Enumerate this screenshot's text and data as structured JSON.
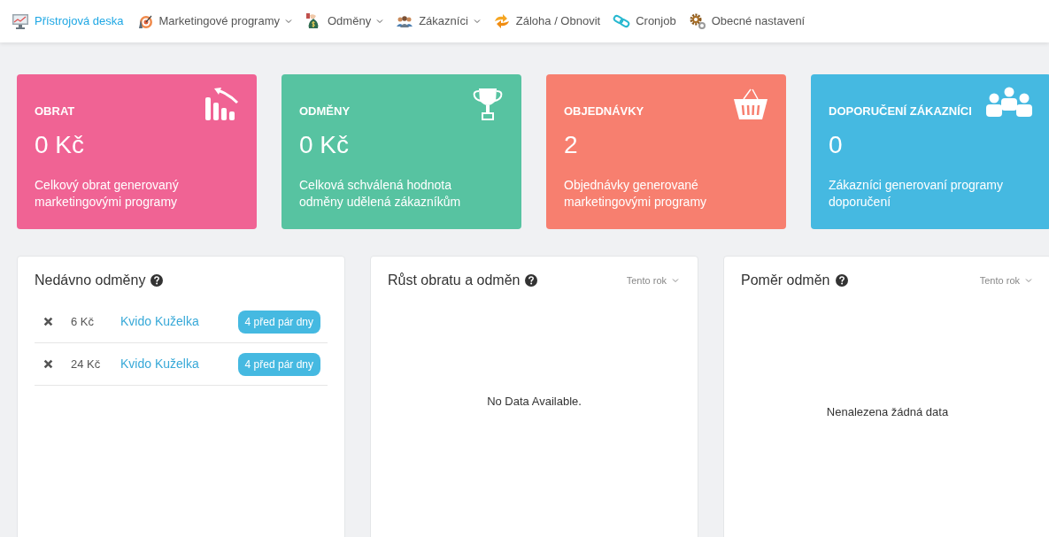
{
  "nav": [
    {
      "label": "Přístrojová deska",
      "selected": true,
      "dropdown": false
    },
    {
      "label": "Marketingové programy",
      "selected": false,
      "dropdown": true
    },
    {
      "label": "Odměny",
      "selected": false,
      "dropdown": true
    },
    {
      "label": "Zákazníci",
      "selected": false,
      "dropdown": true
    },
    {
      "label": "Záloha / Obnovit",
      "selected": false,
      "dropdown": false
    },
    {
      "label": "Cronjob",
      "selected": false,
      "dropdown": false
    },
    {
      "label": "Obecné nastavení",
      "selected": false,
      "dropdown": false
    }
  ],
  "cards": [
    {
      "title": "OBRAT",
      "value": "0 Kč",
      "description": "Celkový obrat generovaný marketingovými programy",
      "color": "#f06394"
    },
    {
      "title": "ODMĚNY",
      "value": "0 Kč",
      "description": "Celková schválená hodnota odměny udělená zákazníkům",
      "color": "#57c3a1"
    },
    {
      "title": "OBJEDNÁVKY",
      "value": "2",
      "description": "Objednávky generované marketingovými programy",
      "color": "#f77f6f"
    },
    {
      "title": "DOPORUČENÍ ZÁKAZNÍCI",
      "value": "0",
      "description": "Zákazníci generovaní programy doporučení",
      "color": "#45b9e1"
    }
  ],
  "recent_rewards": {
    "title": "Nedávno odměny",
    "rows": [
      {
        "amount": "6 Kč",
        "customer": "Kvido Kuželka",
        "badge": "4 před pár dny"
      },
      {
        "amount": "24 Kč",
        "customer": "Kvido Kuželka",
        "badge": "4 před pár dny"
      }
    ]
  },
  "chart_panels": [
    {
      "title": "Růst obratu a odměn",
      "filter": "Tento rok",
      "message": "No Data Available."
    },
    {
      "title": "Poměr odměn",
      "filter": "Tento rok",
      "message": "Nenalezena žádná data"
    }
  ]
}
